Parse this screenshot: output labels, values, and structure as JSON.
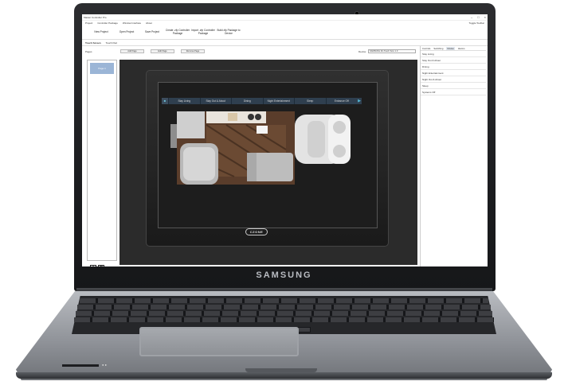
{
  "laptop": {
    "brand": "SAMSUNG"
  },
  "app": {
    "window_title": "Master Controller Pro",
    "menu": [
      "Project",
      "Controller Package",
      "Window Interface",
      "About"
    ],
    "user": "Toggle Toolbar",
    "ribbon": [
      "New Project",
      "Open Project",
      "Save Project",
      "Create .zfp Controller Package",
      "Import .zfp Controller Package",
      "Build zfp Package to Device"
    ],
    "tabs": [
      "Touch Screen",
      "Touch Pad"
    ],
    "pages_label": "Pages",
    "page_buttons": [
      "Add Page",
      "Edit Page",
      "Remove Page"
    ],
    "device_label": "Device:",
    "device_value": "SAMSUNG 9in Touch Scre 1.0",
    "page_item": "Page 1",
    "scene_icon": "■",
    "scenes": [
      "Stay Living",
      "Stay Out & About",
      "Dining",
      "Night Entertainment",
      "Sleep",
      "Entrance Off"
    ],
    "display_brand": "CZONE",
    "right_tabs": [
      "Controls",
      "Switching",
      "Modes",
      "Alarms"
    ],
    "right_active_tab": 2,
    "modes": [
      "Stay Living",
      "Stay Out & About",
      "Dining",
      "Night Entertainment",
      "Night Out & About",
      "Sleep",
      "Systems Off"
    ]
  },
  "colors": {
    "accent": "#53b6d3",
    "page_item": "#9bb5d6",
    "scene_bar": "#2f3f4f"
  }
}
